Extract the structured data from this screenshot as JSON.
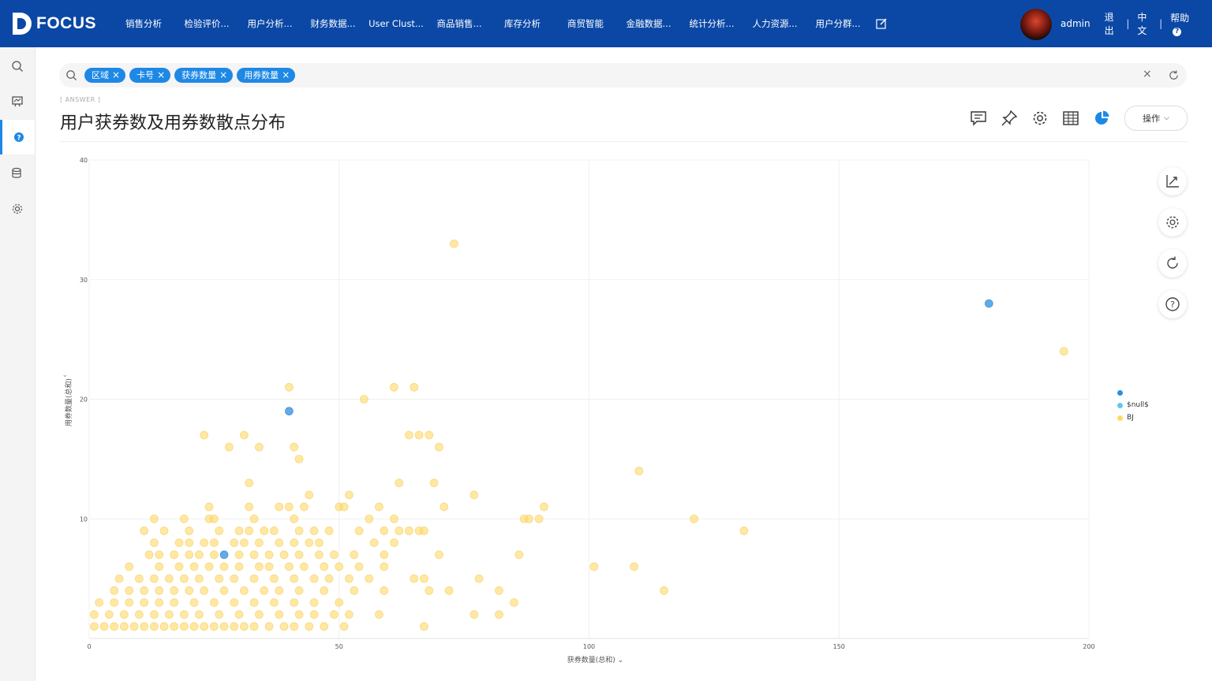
{
  "app": {
    "logo_text": "FOCUS"
  },
  "nav": {
    "items": [
      "销售分析",
      "检验评价...",
      "用户分析...",
      "财务数据...",
      "User Clust...",
      "商品销售...",
      "库存分析",
      "商贸智能",
      "金融数据...",
      "统计分析...",
      "人力资源...",
      "用户分群..."
    ]
  },
  "user": {
    "name": "admin",
    "logout": "退出",
    "lang": "中文",
    "help": "帮助"
  },
  "search": {
    "tags": [
      "区域",
      "卡号",
      "获券数量",
      "用券数量"
    ]
  },
  "answer_label": "[ ANSWER ]",
  "title": "用户获券数及用券数散点分布",
  "operate_label": "操作",
  "colors": {
    "accent": "#1e88e5",
    "topbar": "#0b48a5",
    "series_blue": "#2b8fe0",
    "series_null": "#5ec8f0",
    "series_bj": "#ffd966"
  },
  "legend": [
    {
      "label": "",
      "color": "#2b8fe0"
    },
    {
      "label": "$null$",
      "color": "#5ec8f0"
    },
    {
      "label": "BJ",
      "color": "#ffd966"
    }
  ],
  "chart_data": {
    "type": "scatter",
    "xlabel": "获券数量(总和)",
    "ylabel": "用券数量(总和)",
    "xlim": [
      0,
      200
    ],
    "ylim": [
      0,
      40
    ],
    "xticks": [
      0,
      50,
      100,
      150,
      200
    ],
    "yticks": [
      10,
      20,
      30,
      40
    ],
    "grid": true,
    "legend_position": "right",
    "series": [
      {
        "name": "",
        "color": "#2b8fe0",
        "points": [
          [
            180,
            28
          ],
          [
            40,
            19
          ],
          [
            27,
            7
          ]
        ]
      },
      {
        "name": "$null$",
        "color": "#5ec8f0",
        "points": []
      },
      {
        "name": "BJ",
        "color": "#ffd966",
        "points": [
          [
            73,
            33
          ],
          [
            195,
            24
          ],
          [
            40,
            21
          ],
          [
            61,
            21
          ],
          [
            65,
            21
          ],
          [
            55,
            20
          ],
          [
            23,
            17
          ],
          [
            31,
            17
          ],
          [
            64,
            17
          ],
          [
            66,
            17
          ],
          [
            68,
            17
          ],
          [
            28,
            16
          ],
          [
            34,
            16
          ],
          [
            41,
            16
          ],
          [
            70,
            16
          ],
          [
            42,
            15
          ],
          [
            110,
            14
          ],
          [
            32,
            13
          ],
          [
            62,
            13
          ],
          [
            69,
            13
          ],
          [
            44,
            12
          ],
          [
            52,
            12
          ],
          [
            77,
            12
          ],
          [
            24,
            11
          ],
          [
            32,
            11
          ],
          [
            38,
            11
          ],
          [
            40,
            11
          ],
          [
            43,
            11
          ],
          [
            50,
            11
          ],
          [
            51,
            11
          ],
          [
            58,
            11
          ],
          [
            71,
            11
          ],
          [
            91,
            11
          ],
          [
            13,
            10
          ],
          [
            19,
            10
          ],
          [
            24,
            10
          ],
          [
            25,
            10
          ],
          [
            33,
            10
          ],
          [
            41,
            10
          ],
          [
            56,
            10
          ],
          [
            61,
            10
          ],
          [
            87,
            10
          ],
          [
            88,
            10
          ],
          [
            90,
            10
          ],
          [
            121,
            10
          ],
          [
            11,
            9
          ],
          [
            15,
            9
          ],
          [
            20,
            9
          ],
          [
            26,
            9
          ],
          [
            30,
            9
          ],
          [
            32,
            9
          ],
          [
            35,
            9
          ],
          [
            37,
            9
          ],
          [
            42,
            9
          ],
          [
            45,
            9
          ],
          [
            48,
            9
          ],
          [
            54,
            9
          ],
          [
            59,
            9
          ],
          [
            62,
            9
          ],
          [
            64,
            9
          ],
          [
            66,
            9
          ],
          [
            67,
            9
          ],
          [
            131,
            9
          ],
          [
            13,
            8
          ],
          [
            18,
            8
          ],
          [
            20,
            8
          ],
          [
            23,
            8
          ],
          [
            25,
            8
          ],
          [
            29,
            8
          ],
          [
            31,
            8
          ],
          [
            34,
            8
          ],
          [
            38,
            8
          ],
          [
            41,
            8
          ],
          [
            44,
            8
          ],
          [
            46,
            8
          ],
          [
            57,
            8
          ],
          [
            61,
            8
          ],
          [
            12,
            7
          ],
          [
            14,
            7
          ],
          [
            17,
            7
          ],
          [
            20,
            7
          ],
          [
            22,
            7
          ],
          [
            25,
            7
          ],
          [
            30,
            7
          ],
          [
            33,
            7
          ],
          [
            36,
            7
          ],
          [
            39,
            7
          ],
          [
            42,
            7
          ],
          [
            46,
            7
          ],
          [
            49,
            7
          ],
          [
            53,
            7
          ],
          [
            59,
            7
          ],
          [
            70,
            7
          ],
          [
            86,
            7
          ],
          [
            8,
            6
          ],
          [
            14,
            6
          ],
          [
            18,
            6
          ],
          [
            21,
            6
          ],
          [
            24,
            6
          ],
          [
            27,
            6
          ],
          [
            30,
            6
          ],
          [
            34,
            6
          ],
          [
            36,
            6
          ],
          [
            40,
            6
          ],
          [
            43,
            6
          ],
          [
            47,
            6
          ],
          [
            50,
            6
          ],
          [
            54,
            6
          ],
          [
            59,
            6
          ],
          [
            101,
            6
          ],
          [
            109,
            6
          ],
          [
            6,
            5
          ],
          [
            10,
            5
          ],
          [
            13,
            5
          ],
          [
            16,
            5
          ],
          [
            19,
            5
          ],
          [
            22,
            5
          ],
          [
            26,
            5
          ],
          [
            29,
            5
          ],
          [
            33,
            5
          ],
          [
            37,
            5
          ],
          [
            41,
            5
          ],
          [
            45,
            5
          ],
          [
            48,
            5
          ],
          [
            52,
            5
          ],
          [
            56,
            5
          ],
          [
            65,
            5
          ],
          [
            67,
            5
          ],
          [
            78,
            5
          ],
          [
            5,
            4
          ],
          [
            8,
            4
          ],
          [
            11,
            4
          ],
          [
            14,
            4
          ],
          [
            17,
            4
          ],
          [
            20,
            4
          ],
          [
            23,
            4
          ],
          [
            27,
            4
          ],
          [
            31,
            4
          ],
          [
            35,
            4
          ],
          [
            38,
            4
          ],
          [
            42,
            4
          ],
          [
            47,
            4
          ],
          [
            53,
            4
          ],
          [
            59,
            4
          ],
          [
            68,
            4
          ],
          [
            72,
            4
          ],
          [
            82,
            4
          ],
          [
            115,
            4
          ],
          [
            2,
            3
          ],
          [
            5,
            3
          ],
          [
            8,
            3
          ],
          [
            11,
            3
          ],
          [
            14,
            3
          ],
          [
            17,
            3
          ],
          [
            21,
            3
          ],
          [
            25,
            3
          ],
          [
            29,
            3
          ],
          [
            33,
            3
          ],
          [
            37,
            3
          ],
          [
            41,
            3
          ],
          [
            45,
            3
          ],
          [
            50,
            3
          ],
          [
            85,
            3
          ],
          [
            1,
            2
          ],
          [
            4,
            2
          ],
          [
            7,
            2
          ],
          [
            10,
            2
          ],
          [
            13,
            2
          ],
          [
            16,
            2
          ],
          [
            19,
            2
          ],
          [
            22,
            2
          ],
          [
            26,
            2
          ],
          [
            30,
            2
          ],
          [
            34,
            2
          ],
          [
            38,
            2
          ],
          [
            42,
            2
          ],
          [
            45,
            2
          ],
          [
            49,
            2
          ],
          [
            52,
            2
          ],
          [
            58,
            2
          ],
          [
            77,
            2
          ],
          [
            82,
            2
          ],
          [
            1,
            1
          ],
          [
            3,
            1
          ],
          [
            5,
            1
          ],
          [
            7,
            1
          ],
          [
            9,
            1
          ],
          [
            11,
            1
          ],
          [
            13,
            1
          ],
          [
            15,
            1
          ],
          [
            17,
            1
          ],
          [
            19,
            1
          ],
          [
            21,
            1
          ],
          [
            23,
            1
          ],
          [
            25,
            1
          ],
          [
            27,
            1
          ],
          [
            29,
            1
          ],
          [
            31,
            1
          ],
          [
            33,
            1
          ],
          [
            36,
            1
          ],
          [
            39,
            1
          ],
          [
            41,
            1
          ],
          [
            44,
            1
          ],
          [
            47,
            1
          ],
          [
            51,
            1
          ],
          [
            67,
            1
          ]
        ]
      }
    ]
  }
}
